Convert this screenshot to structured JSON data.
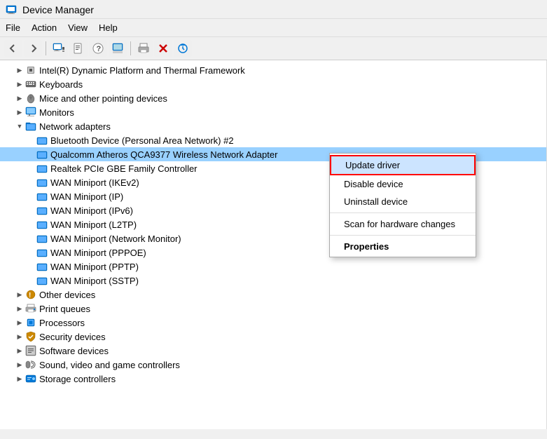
{
  "title_bar": {
    "title": "Device Manager",
    "icon": "🖥"
  },
  "menu_bar": {
    "items": [
      "File",
      "Action",
      "View",
      "Help"
    ]
  },
  "toolbar": {
    "buttons": [
      {
        "name": "back",
        "icon": "←"
      },
      {
        "name": "forward",
        "icon": "→"
      },
      {
        "name": "device-manager-icon",
        "icon": "🖥"
      },
      {
        "name": "unknown1",
        "icon": "📄"
      },
      {
        "name": "help",
        "icon": "❓"
      },
      {
        "name": "update",
        "icon": "📊"
      },
      {
        "name": "print",
        "icon": "🖨"
      },
      {
        "name": "delete",
        "icon": "✖"
      },
      {
        "name": "refresh",
        "icon": "⊕"
      }
    ]
  },
  "tree": {
    "items": [
      {
        "id": "intel",
        "level": 1,
        "expand": "closed",
        "icon": "cpu",
        "label": "Intel(R) Dynamic Platform and Thermal Framework"
      },
      {
        "id": "keyboards",
        "level": 1,
        "expand": "closed",
        "icon": "keyboard",
        "label": "Keyboards"
      },
      {
        "id": "mice",
        "level": 1,
        "expand": "closed",
        "icon": "mouse",
        "label": "Mice and other pointing devices"
      },
      {
        "id": "monitors",
        "level": 1,
        "expand": "closed",
        "icon": "monitor",
        "label": "Monitors"
      },
      {
        "id": "network",
        "level": 1,
        "expand": "open",
        "icon": "network",
        "label": "Network adapters"
      },
      {
        "id": "bluetooth",
        "level": 2,
        "expand": "none",
        "icon": "network",
        "label": "Bluetooth Device (Personal Area Network) #2"
      },
      {
        "id": "qualcomm",
        "level": 2,
        "expand": "none",
        "icon": "network",
        "label": "Qualcomm Atheros QCA9377 Wireless Network Adapter",
        "selected": true
      },
      {
        "id": "realtek",
        "level": 2,
        "expand": "none",
        "icon": "network",
        "label": "Realtek PCIe GBE Family Controller"
      },
      {
        "id": "wan-ikev2",
        "level": 2,
        "expand": "none",
        "icon": "network",
        "label": "WAN Miniport (IKEv2)"
      },
      {
        "id": "wan-ip",
        "level": 2,
        "expand": "none",
        "icon": "network",
        "label": "WAN Miniport (IP)"
      },
      {
        "id": "wan-ipv6",
        "level": 2,
        "expand": "none",
        "icon": "network",
        "label": "WAN Miniport (IPv6)"
      },
      {
        "id": "wan-l2tp",
        "level": 2,
        "expand": "none",
        "icon": "network",
        "label": "WAN Miniport (L2TP)"
      },
      {
        "id": "wan-netmon",
        "level": 2,
        "expand": "none",
        "icon": "network",
        "label": "WAN Miniport (Network Monitor)"
      },
      {
        "id": "wan-pppoe",
        "level": 2,
        "expand": "none",
        "icon": "network",
        "label": "WAN Miniport (PPPOE)"
      },
      {
        "id": "wan-pptp",
        "level": 2,
        "expand": "none",
        "icon": "network",
        "label": "WAN Miniport (PPTP)"
      },
      {
        "id": "wan-sstp",
        "level": 2,
        "expand": "none",
        "icon": "network",
        "label": "WAN Miniport (SSTP)"
      },
      {
        "id": "other",
        "level": 1,
        "expand": "closed",
        "icon": "other",
        "label": "Other devices"
      },
      {
        "id": "print-queues",
        "level": 1,
        "expand": "closed",
        "icon": "print",
        "label": "Print queues"
      },
      {
        "id": "processors",
        "level": 1,
        "expand": "closed",
        "icon": "processor",
        "label": "Processors"
      },
      {
        "id": "security",
        "level": 1,
        "expand": "closed",
        "icon": "security",
        "label": "Security devices"
      },
      {
        "id": "software",
        "level": 1,
        "expand": "closed",
        "icon": "software",
        "label": "Software devices"
      },
      {
        "id": "sound",
        "level": 1,
        "expand": "closed",
        "icon": "sound",
        "label": "Sound, video and game controllers"
      },
      {
        "id": "storage",
        "level": 1,
        "expand": "closed",
        "icon": "storage",
        "label": "Storage controllers"
      }
    ]
  },
  "context_menu": {
    "visible": true,
    "items": [
      {
        "id": "update-driver",
        "label": "Update driver",
        "highlighted": true,
        "separator_after": false
      },
      {
        "id": "disable-device",
        "label": "Disable device",
        "separator_after": false
      },
      {
        "id": "uninstall-device",
        "label": "Uninstall device",
        "separator_after": true
      },
      {
        "id": "scan-hardware",
        "label": "Scan for hardware changes",
        "separator_after": true
      },
      {
        "id": "properties",
        "label": "Properties",
        "bold": true,
        "separator_after": false
      }
    ]
  }
}
